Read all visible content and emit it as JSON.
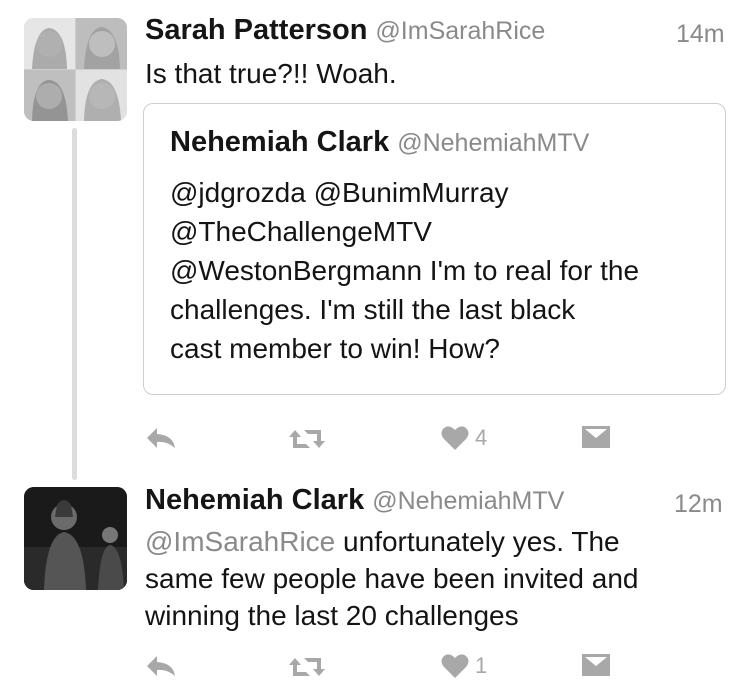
{
  "tweets": [
    {
      "name": "Sarah Patterson",
      "handle": "@ImSarahRice",
      "time": "14m",
      "text": "Is that true?!! Woah.",
      "quoted": {
        "name": "Nehemiah Clark",
        "handle": "@NehemiahMTV",
        "lines": [
          "@jdgrozda @BunimMurray",
          "@TheChallengeMTV",
          "@WestonBergmann I'm to real for the",
          "challenges. I'm still the last black",
          "cast member to win! How?"
        ]
      },
      "likes": "4"
    },
    {
      "name": "Nehemiah Clark",
      "handle": "@NehemiahMTV",
      "time": "12m",
      "mention": "@ImSarahRice",
      "line1_rest": " unfortunately yes. The",
      "line2": "same few people have been invited and",
      "line3": "winning the last 20 challenges",
      "likes": "1"
    }
  ],
  "icons": {
    "reply": "reply-icon",
    "retweet": "retweet-icon",
    "like": "heart-icon",
    "dm": "direct-message-icon"
  },
  "colors": {
    "name": "#151515",
    "secondary": "#8a8a8a",
    "action": "#a8a8a8",
    "border": "#cfcfcf",
    "thread_line": "#dcdcdc"
  }
}
